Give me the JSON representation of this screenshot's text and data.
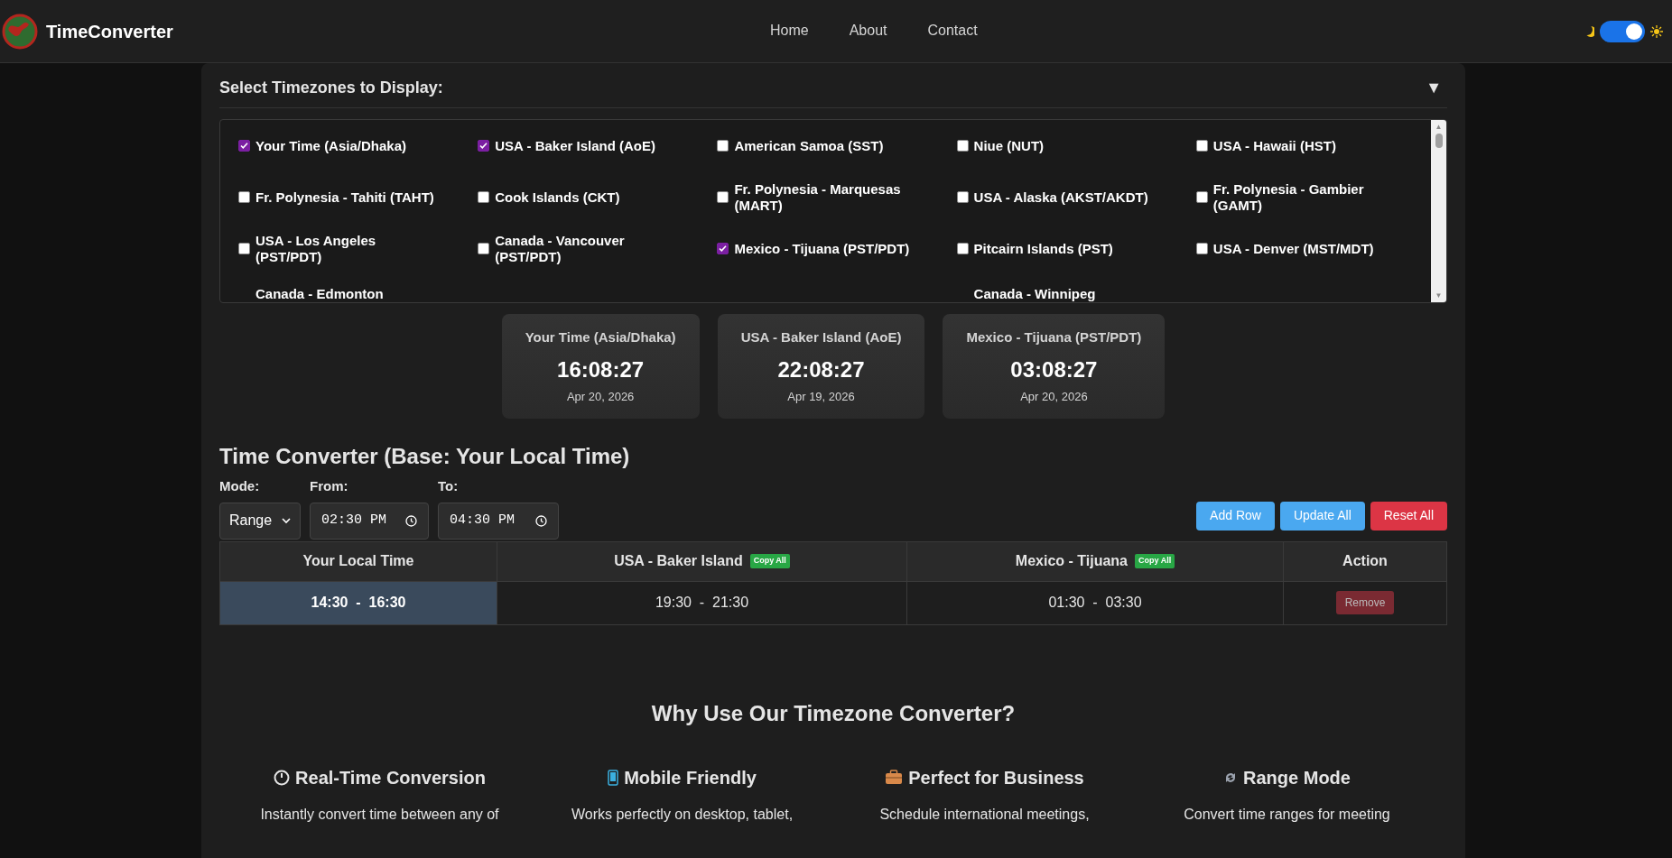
{
  "header": {
    "brand": "TimeConverter",
    "nav": [
      {
        "label": "Home"
      },
      {
        "label": "About"
      },
      {
        "label": "Contact"
      }
    ],
    "theme_toggle": {
      "on": true
    }
  },
  "timezones": {
    "title": "Select Timezones to Display:",
    "collapse_icon": "▼",
    "items": [
      {
        "label": "Your Time (Asia/Dhaka)",
        "checked": true
      },
      {
        "label": "USA - Baker Island (AoE)",
        "checked": true
      },
      {
        "label": "American Samoa (SST)",
        "checked": false
      },
      {
        "label": "Niue (NUT)",
        "checked": false
      },
      {
        "label": "USA - Hawaii (HST)",
        "checked": false
      },
      {
        "label": "Fr. Polynesia - Tahiti (TAHT)",
        "checked": false
      },
      {
        "label": "Cook Islands (CKT)",
        "checked": false
      },
      {
        "label": "Fr. Polynesia - Marquesas (MART)",
        "checked": false
      },
      {
        "label": "USA - Alaska (AKST/AKDT)",
        "checked": false
      },
      {
        "label": "Fr. Polynesia - Gambier (GAMT)",
        "checked": false
      },
      {
        "label": "USA - Los Angeles (PST/PDT)",
        "checked": false
      },
      {
        "label": "Canada - Vancouver (PST/PDT)",
        "checked": false
      },
      {
        "label": "Mexico - Tijuana (PST/PDT)",
        "checked": true
      },
      {
        "label": "Pitcairn Islands (PST)",
        "checked": false
      },
      {
        "label": "USA - Denver (MST/MDT)",
        "checked": false
      }
    ],
    "cut_off_items": [
      {
        "label": "Canada - Edmonton"
      },
      {
        "label": "Canada - Winnipeg"
      }
    ],
    "scroll_up": "▲",
    "scroll_down": "▼"
  },
  "clocks": [
    {
      "label": "Your Time (Asia/Dhaka)",
      "time": "16:08:27",
      "date": "Apr 20, 2026"
    },
    {
      "label": "USA - Baker Island (AoE)",
      "time": "22:08:27",
      "date": "Apr 19, 2026"
    },
    {
      "label": "Mexico - Tijuana (PST/PDT)",
      "time": "03:08:27",
      "date": "Apr 20, 2026"
    }
  ],
  "converter": {
    "title": "Time Converter (Base: Your Local Time)",
    "mode": {
      "label": "Mode:",
      "value": "Range"
    },
    "from": {
      "label": "From:",
      "value": "02:30 PM"
    },
    "to": {
      "label": "To:",
      "value": "04:30 PM"
    },
    "buttons": [
      {
        "label": "Add Row",
        "kind": "add"
      },
      {
        "label": "Update All",
        "kind": "update"
      },
      {
        "label": "Reset All",
        "kind": "reset"
      }
    ],
    "columns": [
      {
        "label": "Your Local Time"
      },
      {
        "label": "USA - Baker Island",
        "copy": "Copy All"
      },
      {
        "label": "Mexico - Tijuana",
        "copy": "Copy All"
      },
      {
        "label": "Action"
      }
    ],
    "rows": [
      {
        "cells": [
          "14:30  -  16:30",
          "19:30  -  21:30",
          "01:30  -  03:30"
        ],
        "action": "Remove"
      }
    ]
  },
  "features": {
    "title": "Why Use Our Timezone Converter?",
    "items": [
      {
        "kind": "clock",
        "title": "Real-Time Conversion",
        "text": "Instantly convert time between any of"
      },
      {
        "kind": "phone",
        "title": "Mobile Friendly",
        "text": "Works perfectly on desktop, tablet,"
      },
      {
        "kind": "briefcase",
        "title": "Perfect for Business",
        "text": "Schedule international meetings,"
      },
      {
        "kind": "cycle",
        "title": "Range Mode",
        "text": "Convert time ranges for meeting"
      }
    ]
  }
}
